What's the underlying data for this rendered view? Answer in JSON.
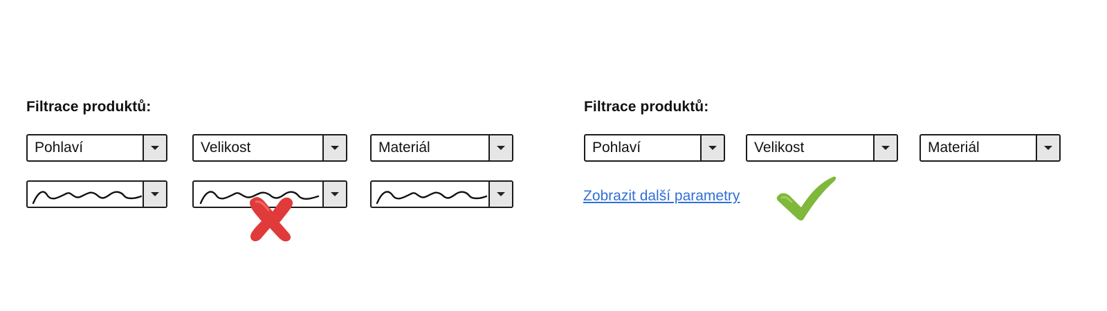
{
  "left_panel": {
    "heading": "Filtrace produktů:",
    "selects": [
      {
        "label": "Pohlaví"
      },
      {
        "label": "Velikost"
      },
      {
        "label": "Materiál"
      }
    ],
    "illegible_selects_count": 3,
    "verdict_icon": "red-x-icon",
    "verdict_color": "#e03a3a"
  },
  "right_panel": {
    "heading": "Filtrace produktů:",
    "selects": [
      {
        "label": "Pohlaví"
      },
      {
        "label": "Velikost"
      },
      {
        "label": "Materiál"
      }
    ],
    "more_link": "Zobrazit další parametry",
    "link_color": "#2f6fd6",
    "verdict_icon": "green-checkmark-icon",
    "verdict_color": "#7fb83a"
  }
}
